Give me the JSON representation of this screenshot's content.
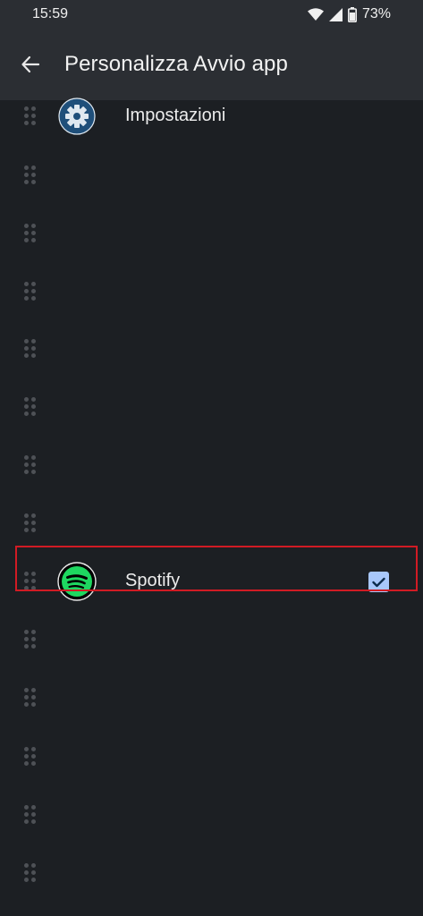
{
  "status_bar": {
    "time": "15:59",
    "battery": "73%",
    "icons": [
      "wifi-icon",
      "signal-icon",
      "battery-icon"
    ]
  },
  "app_bar": {
    "title": "Personalizza Avvio app",
    "back_icon": "back-arrow-icon"
  },
  "apps": [
    {
      "label": "Impostazioni",
      "icon": "settings-gear-icon",
      "checked": false
    },
    {
      "label": "",
      "icon": "",
      "checked": false
    },
    {
      "label": "",
      "icon": "",
      "checked": false
    },
    {
      "label": "",
      "icon": "",
      "checked": false
    },
    {
      "label": "",
      "icon": "",
      "checked": false
    },
    {
      "label": "",
      "icon": "",
      "checked": false
    },
    {
      "label": "",
      "icon": "",
      "checked": false
    },
    {
      "label": "",
      "icon": "",
      "checked": false
    },
    {
      "label": "Spotify",
      "icon": "spotify-icon",
      "checked": true
    },
    {
      "label": "",
      "icon": "",
      "checked": false
    },
    {
      "label": "",
      "icon": "",
      "checked": false
    },
    {
      "label": "",
      "icon": "",
      "checked": false
    },
    {
      "label": "",
      "icon": "",
      "checked": false
    },
    {
      "label": "",
      "icon": "",
      "checked": false
    }
  ],
  "colors": {
    "background": "#1c1f23",
    "app_bar": "#2b2e33",
    "checkbox": "#a8c7fa",
    "highlight": "#d11b24",
    "spotify_green": "#1ed760"
  }
}
